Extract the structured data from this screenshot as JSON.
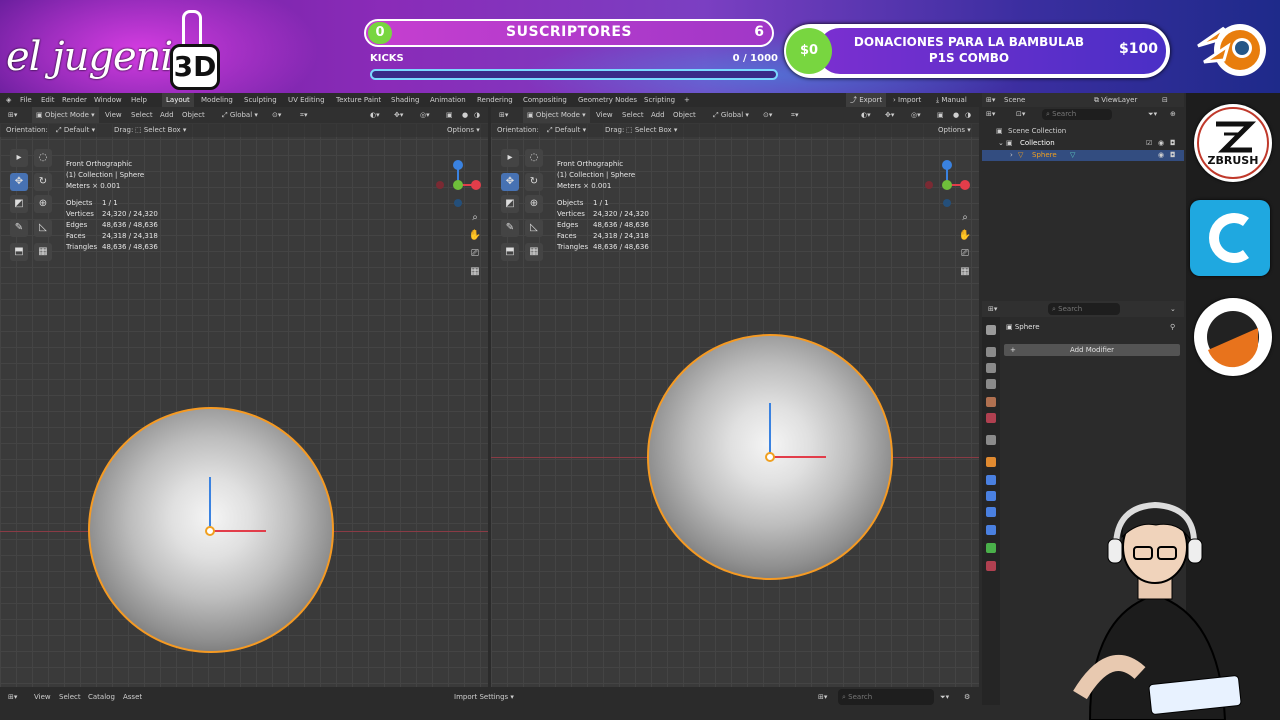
{
  "stream": {
    "logo_script": "el jugenio",
    "logo_3d": "3D",
    "subs_current": "0",
    "subs_label": "SUSCRIPTORES",
    "subs_goal": "6",
    "kicks_label": "KICKS",
    "kicks_value": "0 / 1000",
    "donation_amount": "$0",
    "donation_title_1": "DONACIONES PARA LA BAMBULAB",
    "donation_title_2": "P1S COMBO",
    "donation_goal": "$100",
    "apps": [
      "blender-icon",
      "zbrush-icon",
      "cura-icon",
      "bambu-icon"
    ],
    "zbrush_label": "ZBRUSH"
  },
  "menu": {
    "items": [
      "File",
      "Edit",
      "Render",
      "Window",
      "Help"
    ],
    "workspaces": [
      "Layout",
      "Modeling",
      "Sculpting",
      "UV Editing",
      "Texture Paint",
      "Shading",
      "Animation",
      "Rendering",
      "Compositing",
      "Geometry Nodes",
      "Scripting"
    ],
    "active_workspace": "Layout",
    "export": "Export",
    "import": "Import",
    "manual": "Manual"
  },
  "viewport_left": {
    "mode": "Object Mode",
    "menus": [
      "View",
      "Select",
      "Add",
      "Object"
    ],
    "transform": "Global",
    "orientation_label": "Orientation:",
    "orientation_value": "Default",
    "drag_label": "Drag:",
    "drag_value": "Select Box",
    "options": "Options",
    "view_name": "Front Orthographic",
    "collection": "(1) Collection | Sphere",
    "units": "Meters × 0.001",
    "stats": [
      {
        "k": "Objects",
        "v": "1 / 1"
      },
      {
        "k": "Vertices",
        "v": "24,320 / 24,320"
      },
      {
        "k": "Edges",
        "v": "48,636 / 48,636"
      },
      {
        "k": "Faces",
        "v": "24,318 / 24,318"
      },
      {
        "k": "Triangles",
        "v": "48,636 / 48,636"
      }
    ]
  },
  "viewport_right": {
    "mode": "Object Mode",
    "menus": [
      "View",
      "Select",
      "Add",
      "Object"
    ],
    "transform": "Global",
    "orientation_label": "Orientation:",
    "orientation_value": "Default",
    "drag_label": "Drag:",
    "drag_value": "Select Box",
    "options": "Options",
    "view_name": "Front Orthographic",
    "collection": "(1) Collection | Sphere",
    "units": "Meters × 0.001",
    "stats": [
      {
        "k": "Objects",
        "v": "1 / 1"
      },
      {
        "k": "Vertices",
        "v": "24,320 / 24,320"
      },
      {
        "k": "Edges",
        "v": "48,636 / 48,636"
      },
      {
        "k": "Faces",
        "v": "24,318 / 24,318"
      },
      {
        "k": "Triangles",
        "v": "48,636 / 48,636"
      }
    ]
  },
  "outliner": {
    "scene": "Scene",
    "view_layer": "ViewLayer",
    "search_placeholder": "Search",
    "scene_collection": "Scene Collection",
    "collection": "Collection",
    "object": "Sphere"
  },
  "properties": {
    "search_placeholder": "Search",
    "object_name": "Sphere",
    "add_modifier": "Add Modifier"
  },
  "statusbar": {
    "menus": [
      "View",
      "Select",
      "Catalog",
      "Asset"
    ],
    "import_settings": "Import Settings",
    "search_placeholder": "Search"
  },
  "colors": {
    "selection": "#f59a23",
    "x_axis": "#e23d4a",
    "y_axis": "#6fbf3a",
    "z_axis": "#3a82e0",
    "active_tool": "#4772b3"
  }
}
